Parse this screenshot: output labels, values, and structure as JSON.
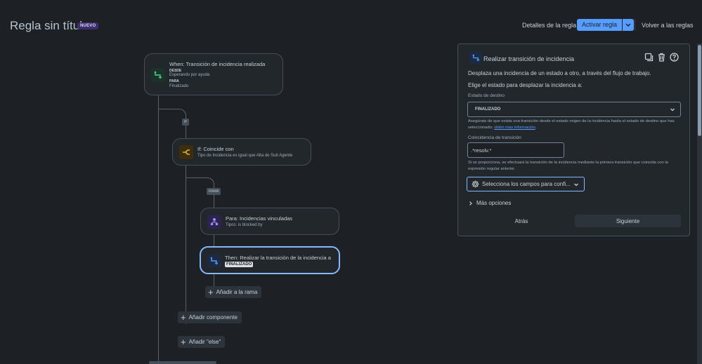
{
  "header": {
    "title": "Regla sin título",
    "badge": "NUEVO",
    "rule_details": "Detalles de la regla",
    "activate": "Activar regla",
    "back_to_rules": "Volver a las reglas"
  },
  "canvas": {
    "trigger": {
      "title": "When: Transición de incidencia realizada",
      "from_label": "DESDE",
      "from_value": "Esperando por ayuda",
      "to_label": "PARA",
      "to_value": "Finalizado"
    },
    "if_tag": "IF",
    "condition": {
      "title": "If: Coincide con",
      "subtitle": "Tipo de Incidencia es igual que Alta de Sub Agente"
    },
    "branch_tag": "RAMA",
    "branch": {
      "title": "Para: Incidencias vinculadas",
      "subtitle": "Tipos: is blocked by"
    },
    "action": {
      "title": "Then: Realizar la transición de la incidencia a",
      "status": "FINALIZADO"
    },
    "add_to_branch": "Añadir a la rama",
    "add_component": "Añadir componente",
    "add_else": "Añadir \"else\""
  },
  "panel": {
    "title": "Realizar transición de incidencia",
    "description": "Desplaza una incidencia de un estado a otro, a través del flujo de trabajo.",
    "choose": "Elige el estado para desplazar la incidencia a:",
    "dest_label": "Estado de destino",
    "dest_value": "FINALIZADO",
    "help1": "Asegúrate de que exista una transición desde el estado origen de la incidencia hasta el estado de destino que has seleccionado; ",
    "help1_link": "obtén más información",
    "help1_end": ".",
    "match_label": "Coincidencia de transición",
    "match_value": ".*resolv.*",
    "help2": "Si se proporciona, se efectuará la transición de la incidencia mediante la primera transición que coincida con la expresión regular anterior.",
    "fields_btn": "Selecciona los campos para confi...",
    "more_options": "Más opciones",
    "back": "Atrás",
    "next": "Siguiente"
  },
  "colors": {
    "background": "#1d2125",
    "accent": "#579dff",
    "selected_border": "#85b8ff"
  }
}
